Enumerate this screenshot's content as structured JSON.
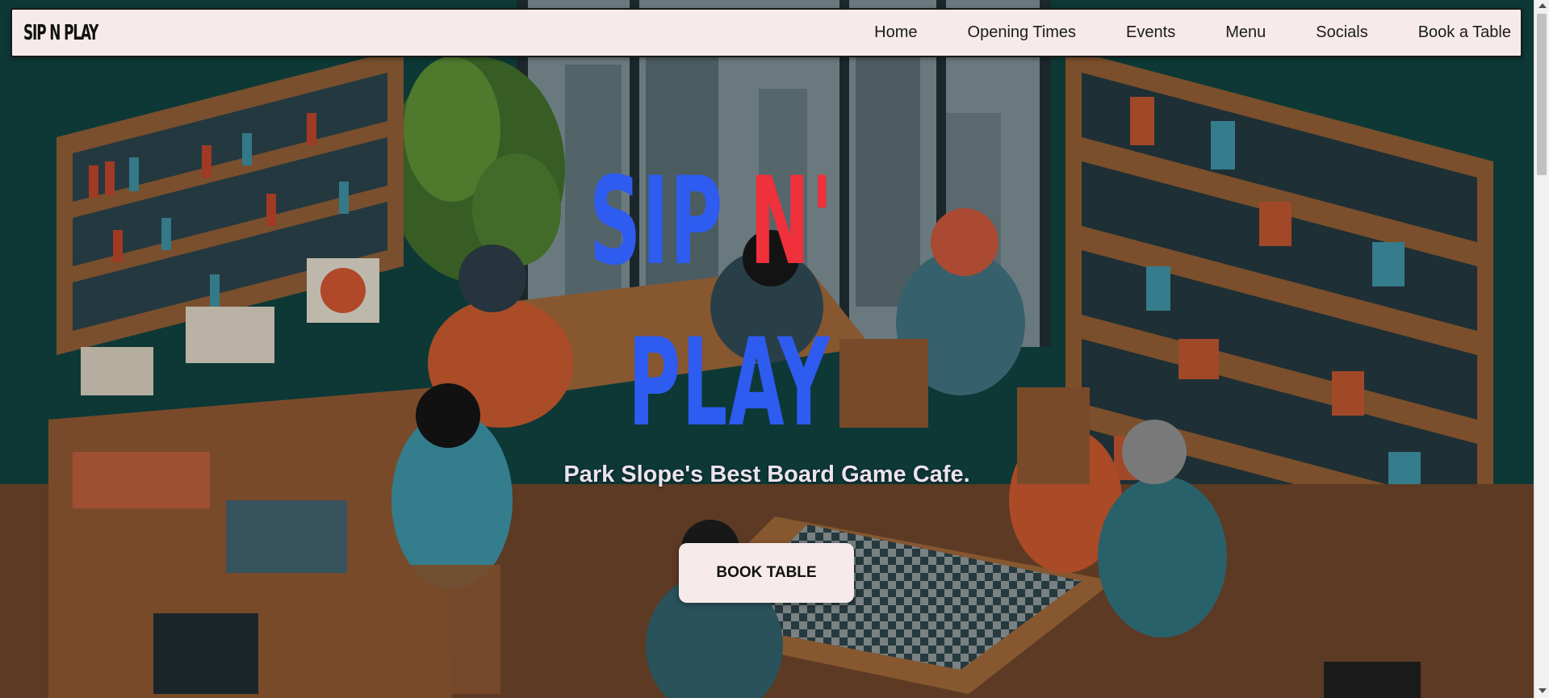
{
  "nav": {
    "brand": "SIP N PLAY",
    "links": [
      "Home",
      "Opening Times",
      "Events",
      "Menu",
      "Socials",
      "Book a Table"
    ]
  },
  "hero": {
    "title_part1": "SIP ",
    "title_part2": "N'",
    "title_line2": "PLAY",
    "tagline": "Park Slope's Best Board Game Cafe.",
    "button_label": "BOOK TABLE"
  },
  "colors": {
    "title_blue": "#2e5bf0",
    "title_red": "#f0303a",
    "nav_bg": "#f6eaea",
    "hero_bg": "#0d3d3b"
  }
}
